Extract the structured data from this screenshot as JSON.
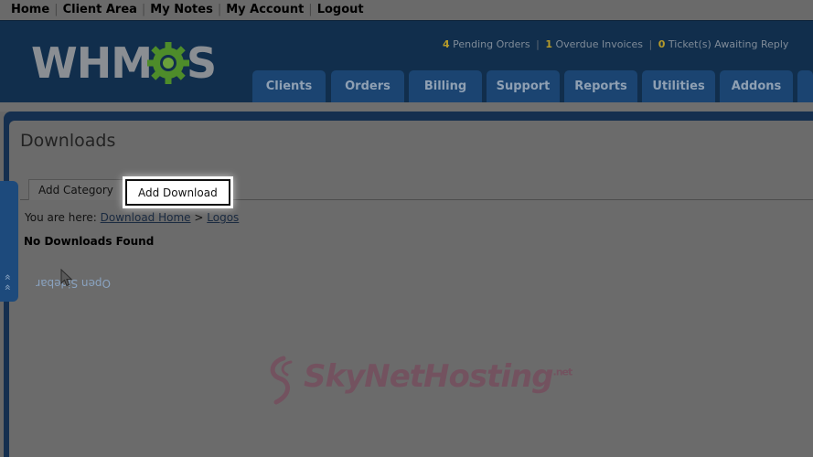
{
  "topnav": {
    "items": [
      "Home",
      "Client Area",
      "My Notes",
      "My Account",
      "Logout"
    ]
  },
  "header": {
    "logo_text": "WHMCS",
    "stats": {
      "pending_count": "4",
      "pending_label": "Pending Orders",
      "overdue_count": "1",
      "overdue_label": "Overdue Invoices",
      "tickets_count": "0",
      "tickets_label": "Ticket(s) Awaiting Reply"
    },
    "tabs": [
      "Clients",
      "Orders",
      "Billing",
      "Support",
      "Reports",
      "Utilities",
      "Addons"
    ]
  },
  "content": {
    "title": "Downloads",
    "tabs": [
      "Add Category",
      "Add Download"
    ],
    "breadcrumb_prefix": "You are here:",
    "breadcrumb_home": "Download Home",
    "breadcrumb_sep": ">",
    "breadcrumb_current": "Logos",
    "empty_message": "No Downloads Found"
  },
  "sidebar": {
    "toggle_label": "Open Sidebar"
  },
  "watermark": {
    "text": "SkyNetHosting",
    "suffix": ".net"
  },
  "colors": {
    "accent_count": "#b59a2a",
    "header_bg": "#112e4c",
    "tab_bg": "#1b4471"
  }
}
